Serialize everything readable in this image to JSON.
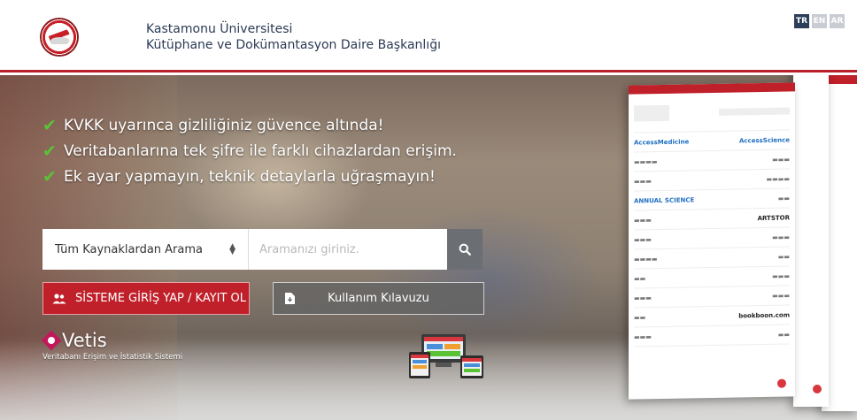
{
  "header": {
    "university": "Kastamonu Üniversitesi",
    "department": "Kütüphane ve Dokümantasyon Daire Başkanlığı",
    "languages": [
      {
        "code": "TR",
        "active": true
      },
      {
        "code": "EN",
        "active": false
      },
      {
        "code": "AR",
        "active": false
      }
    ]
  },
  "hero": {
    "claims": [
      "KVKK uyarınca gizliliğiniz güvence altında!",
      "Veritabanlarına tek şifre ile farklı cihazlardan erişim.",
      "Ek ayar yapmayın, teknik detaylarla uğraşmayın!"
    ]
  },
  "search": {
    "scope_selected": "Tüm Kaynaklardan Arama",
    "placeholder": "Aramanızı giriniz.",
    "button_icon": "search-icon"
  },
  "buttons": {
    "login_label": "SİSTEME GİRİŞ YAP / KAYIT OL",
    "login_icon": "users-icon",
    "guide_label": "Kullanım Kılavuzu",
    "guide_icon": "download-document-icon"
  },
  "vetis": {
    "name": "Vetis",
    "tagline": "Veritabanı Erişim ve İstatistik Sistemi"
  },
  "preview": {
    "brands": [
      "AccessMedicine",
      "ANNUAL SCIENCE",
      "ARTSTOR",
      "bookboon.com",
      "AccessScience"
    ]
  },
  "colors": {
    "accent_red": "#c0202a",
    "check_green": "#5bc236",
    "header_text": "#2a3a55",
    "lang_active": "#2c3e58"
  }
}
